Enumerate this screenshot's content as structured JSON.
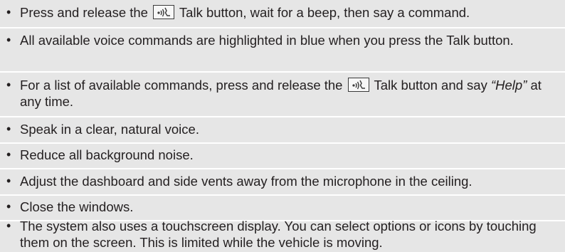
{
  "bullets": {
    "b1": {
      "pre": "Press and release the",
      "post": "Talk button, wait for a beep, then say a command."
    },
    "b2": {
      "text": "All available voice commands are highlighted in blue when you press the Talk button."
    },
    "b3": {
      "pre": "For a list of available commands, press and release the",
      "mid": "Talk button and say",
      "quote": "“Help”",
      "post": " at any time."
    },
    "b4": {
      "text": "Speak in a clear, natural voice."
    },
    "b5": {
      "text": "Reduce all background noise."
    },
    "b6": {
      "text": "Adjust the dashboard and side vents away from the microphone in the ceiling."
    },
    "b7": {
      "text": "Close the windows."
    },
    "b8": {
      "text": "The system also uses a touchscreen display. You can select options or icons by touching them on the screen. This is limited while the vehicle is moving."
    }
  },
  "bullet_glyph": "•",
  "icons": {
    "talk_button": "voice-talk-icon"
  },
  "colors": {
    "background": "#e6e6e6",
    "text": "#231f20",
    "divider": "#ffffff"
  }
}
